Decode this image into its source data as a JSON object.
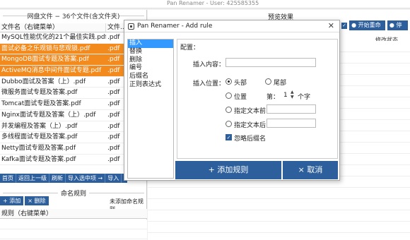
{
  "app": {
    "title": "Pan Renamer - User: 425585355"
  },
  "left": {
    "group_title": "网盘文件 − 36个文件(含文件夹)",
    "col_name": "文件名（右键菜单）",
    "col_type": "文件...",
    "files": [
      {
        "name": "MySQL性能优化的21个最佳实践.pdf",
        "ext": ".pdf"
      },
      {
        "name": "面试必备之乐观锁与悲观锁.pdf",
        "ext": ".pdf"
      },
      {
        "name": "MongoDB面试专题及答案.pdf",
        "ext": ".pdf"
      },
      {
        "name": "ActiveMQ消息中间件面试专题.pdf",
        "ext": ".pdf"
      },
      {
        "name": "Dubbo面试及答案（上）.pdf",
        "ext": ".pdf"
      },
      {
        "name": "微服务面试专题及答案.pdf",
        "ext": ".pdf"
      },
      {
        "name": "Tomcat面试专题及答案.pdf",
        "ext": ".pdf"
      },
      {
        "name": "Nginx面试专题及答案（上）.pdf",
        "ext": ".pdf"
      },
      {
        "name": "并发编程及答案（上）.pdf",
        "ext": ".pdf"
      },
      {
        "name": "多线程面试专题及答案.pdf",
        "ext": ".pdf"
      },
      {
        "name": "Netty面试专题及答案.pdf",
        "ext": ".pdf"
      },
      {
        "name": "Kafka面试专题及答案.pdf",
        "ext": ".pdf"
      }
    ],
    "buttons": [
      "首页",
      "返回上一级",
      "刷新",
      "导入选中项 →",
      "导入"
    ]
  },
  "rules": {
    "title": "命名规则",
    "add": "+ 添加",
    "delete": "× 删除",
    "note": "未添加命名规则",
    "col": "规则（右键菜单）"
  },
  "right": {
    "preview_title": "预览效果",
    "start_btn": "● 开始重命名",
    "stop_btn": "● 停止",
    "status_col": "修改状态"
  },
  "dialog": {
    "title": "Pan Renamer - Add rule",
    "close": "✕",
    "types": [
      "插入",
      "替换",
      "删除",
      "编号",
      "后缀名",
      "正则表达式"
    ],
    "config_label": "配置：",
    "insert_content_label": "插入内容：",
    "insert_pos_label": "插入位置：",
    "pos_head": "头部",
    "pos_tail": "尾部",
    "pos_position": "位置",
    "pos_nth_label": "第：",
    "pos_nth_value": "1",
    "pos_unit": "个字",
    "pos_before_text": "指定文本前",
    "pos_after_text": "指定文本后",
    "ignore_ext": "忽略后缀名",
    "add_rule": "+ 添加规则",
    "cancel": "× 取消"
  },
  "colors": {
    "accent": "#2c5f9c",
    "selection": "#f28a1d",
    "list_selection": "#3399ff"
  }
}
